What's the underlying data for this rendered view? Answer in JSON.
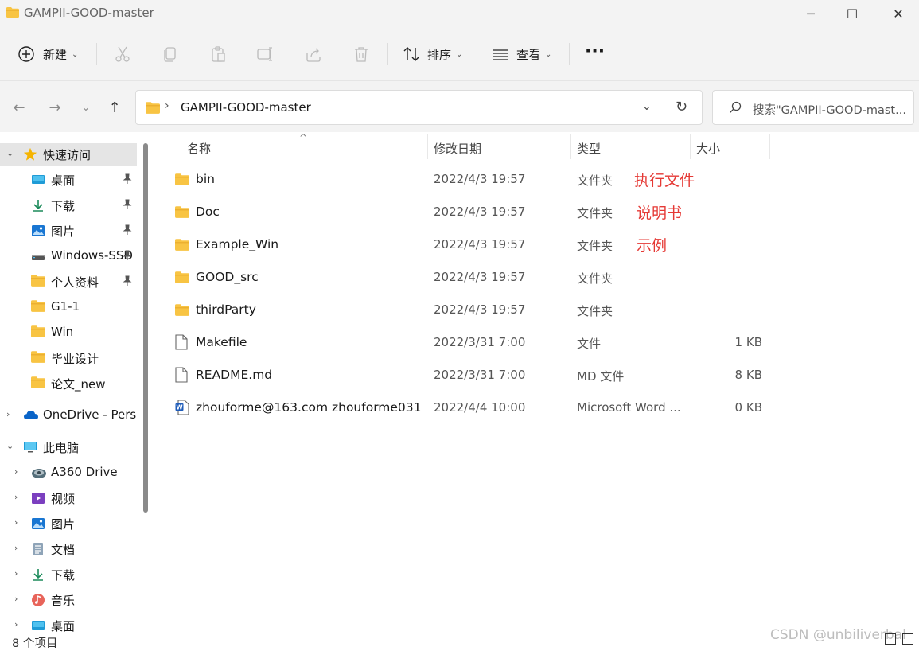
{
  "window": {
    "title": "GAMPII-GOOD-master",
    "min_glyph": "─",
    "max_glyph": "☐",
    "close_glyph": "✕"
  },
  "toolbar": {
    "new_label": "新建",
    "sort_label": "排序",
    "view_label": "查看",
    "more_label": "···",
    "caret": "⌄"
  },
  "nav": {
    "back": "←",
    "forward": "→",
    "recent": "⌄",
    "up": "↑"
  },
  "address": {
    "separator": "›",
    "path": "GAMPII-GOOD-master",
    "dropdown": "⌄",
    "refresh": "↻"
  },
  "search": {
    "placeholder": "搜索\"GAMPII-GOOD-mast..."
  },
  "sidebar": {
    "items": [
      {
        "label": "快速访问",
        "icon": "star-icon",
        "expand": "⌄",
        "pinned": false,
        "selected": true
      },
      {
        "label": "桌面",
        "icon": "desktop-icon",
        "pinned": true
      },
      {
        "label": "下载",
        "icon": "download-icon",
        "pinned": true
      },
      {
        "label": "图片",
        "icon": "pictures-icon",
        "pinned": true
      },
      {
        "label": "Windows-SSD",
        "icon": "drive-icon",
        "pinned": true
      },
      {
        "label": "个人资料",
        "icon": "folder-icon",
        "pinned": true
      },
      {
        "label": "G1-1",
        "icon": "folder-icon",
        "pinned": false
      },
      {
        "label": "Win",
        "icon": "folder-icon",
        "pinned": false
      },
      {
        "label": "毕业设计",
        "icon": "folder-icon",
        "pinned": false
      },
      {
        "label": "论文_new",
        "icon": "folder-icon",
        "pinned": false
      },
      {
        "label": "OneDrive - Personal",
        "icon": "cloud-icon",
        "expand": "›"
      },
      {
        "label": "此电脑",
        "icon": "pc-icon",
        "expand": "⌄"
      },
      {
        "label": "A360 Drive",
        "icon": "a360-icon",
        "expand": "›"
      },
      {
        "label": "视频",
        "icon": "videos-icon",
        "expand": "›"
      },
      {
        "label": "图片",
        "icon": "pictures-icon",
        "expand": "›"
      },
      {
        "label": "文档",
        "icon": "documents-icon",
        "expand": "›"
      },
      {
        "label": "下载",
        "icon": "download-icon",
        "expand": "›"
      },
      {
        "label": "音乐",
        "icon": "music-icon",
        "expand": "›"
      },
      {
        "label": "桌面",
        "icon": "desktop-icon",
        "expand": "›"
      }
    ],
    "pin_glyph": "📌"
  },
  "columns": {
    "name": "名称",
    "modified": "修改日期",
    "type": "类型",
    "size": "大小",
    "sort_glyph": "^"
  },
  "files": [
    {
      "name": "bin",
      "date": "2022/4/3 19:57",
      "type": "文件夹",
      "size": "",
      "icon": "folder-icon",
      "note": "执行文件"
    },
    {
      "name": "Doc",
      "date": "2022/4/3 19:57",
      "type": "文件夹",
      "size": "",
      "icon": "folder-icon",
      "note": "说明书"
    },
    {
      "name": "Example_Win",
      "date": "2022/4/3 19:57",
      "type": "文件夹",
      "size": "",
      "icon": "folder-icon",
      "note": "示例"
    },
    {
      "name": "GOOD_src",
      "date": "2022/4/3 19:57",
      "type": "文件夹",
      "size": "",
      "icon": "folder-icon",
      "note": ""
    },
    {
      "name": "thirdParty",
      "date": "2022/4/3 19:57",
      "type": "文件夹",
      "size": "",
      "icon": "folder-icon",
      "note": ""
    },
    {
      "name": "Makefile",
      "date": "2022/3/31 7:00",
      "type": "文件",
      "size": "1 KB",
      "icon": "file-icon",
      "note": ""
    },
    {
      "name": "README.md",
      "date": "2022/3/31 7:00",
      "type": "MD 文件",
      "size": "8 KB",
      "icon": "file-icon",
      "note": ""
    },
    {
      "name": "zhouforme@163.com zhouforme031...",
      "date": "2022/4/4 10:00",
      "type": "Microsoft Word ...",
      "size": "0 KB",
      "icon": "word-icon",
      "note": ""
    }
  ],
  "status": {
    "count": "8 个项目",
    "watermark": "CSDN @unbiliverbal"
  },
  "colors": {
    "folder": "#f8c443",
    "folder_dark": "#e8a92a",
    "annotation": "#e53935",
    "selected_bg": "#e5e5e5"
  }
}
